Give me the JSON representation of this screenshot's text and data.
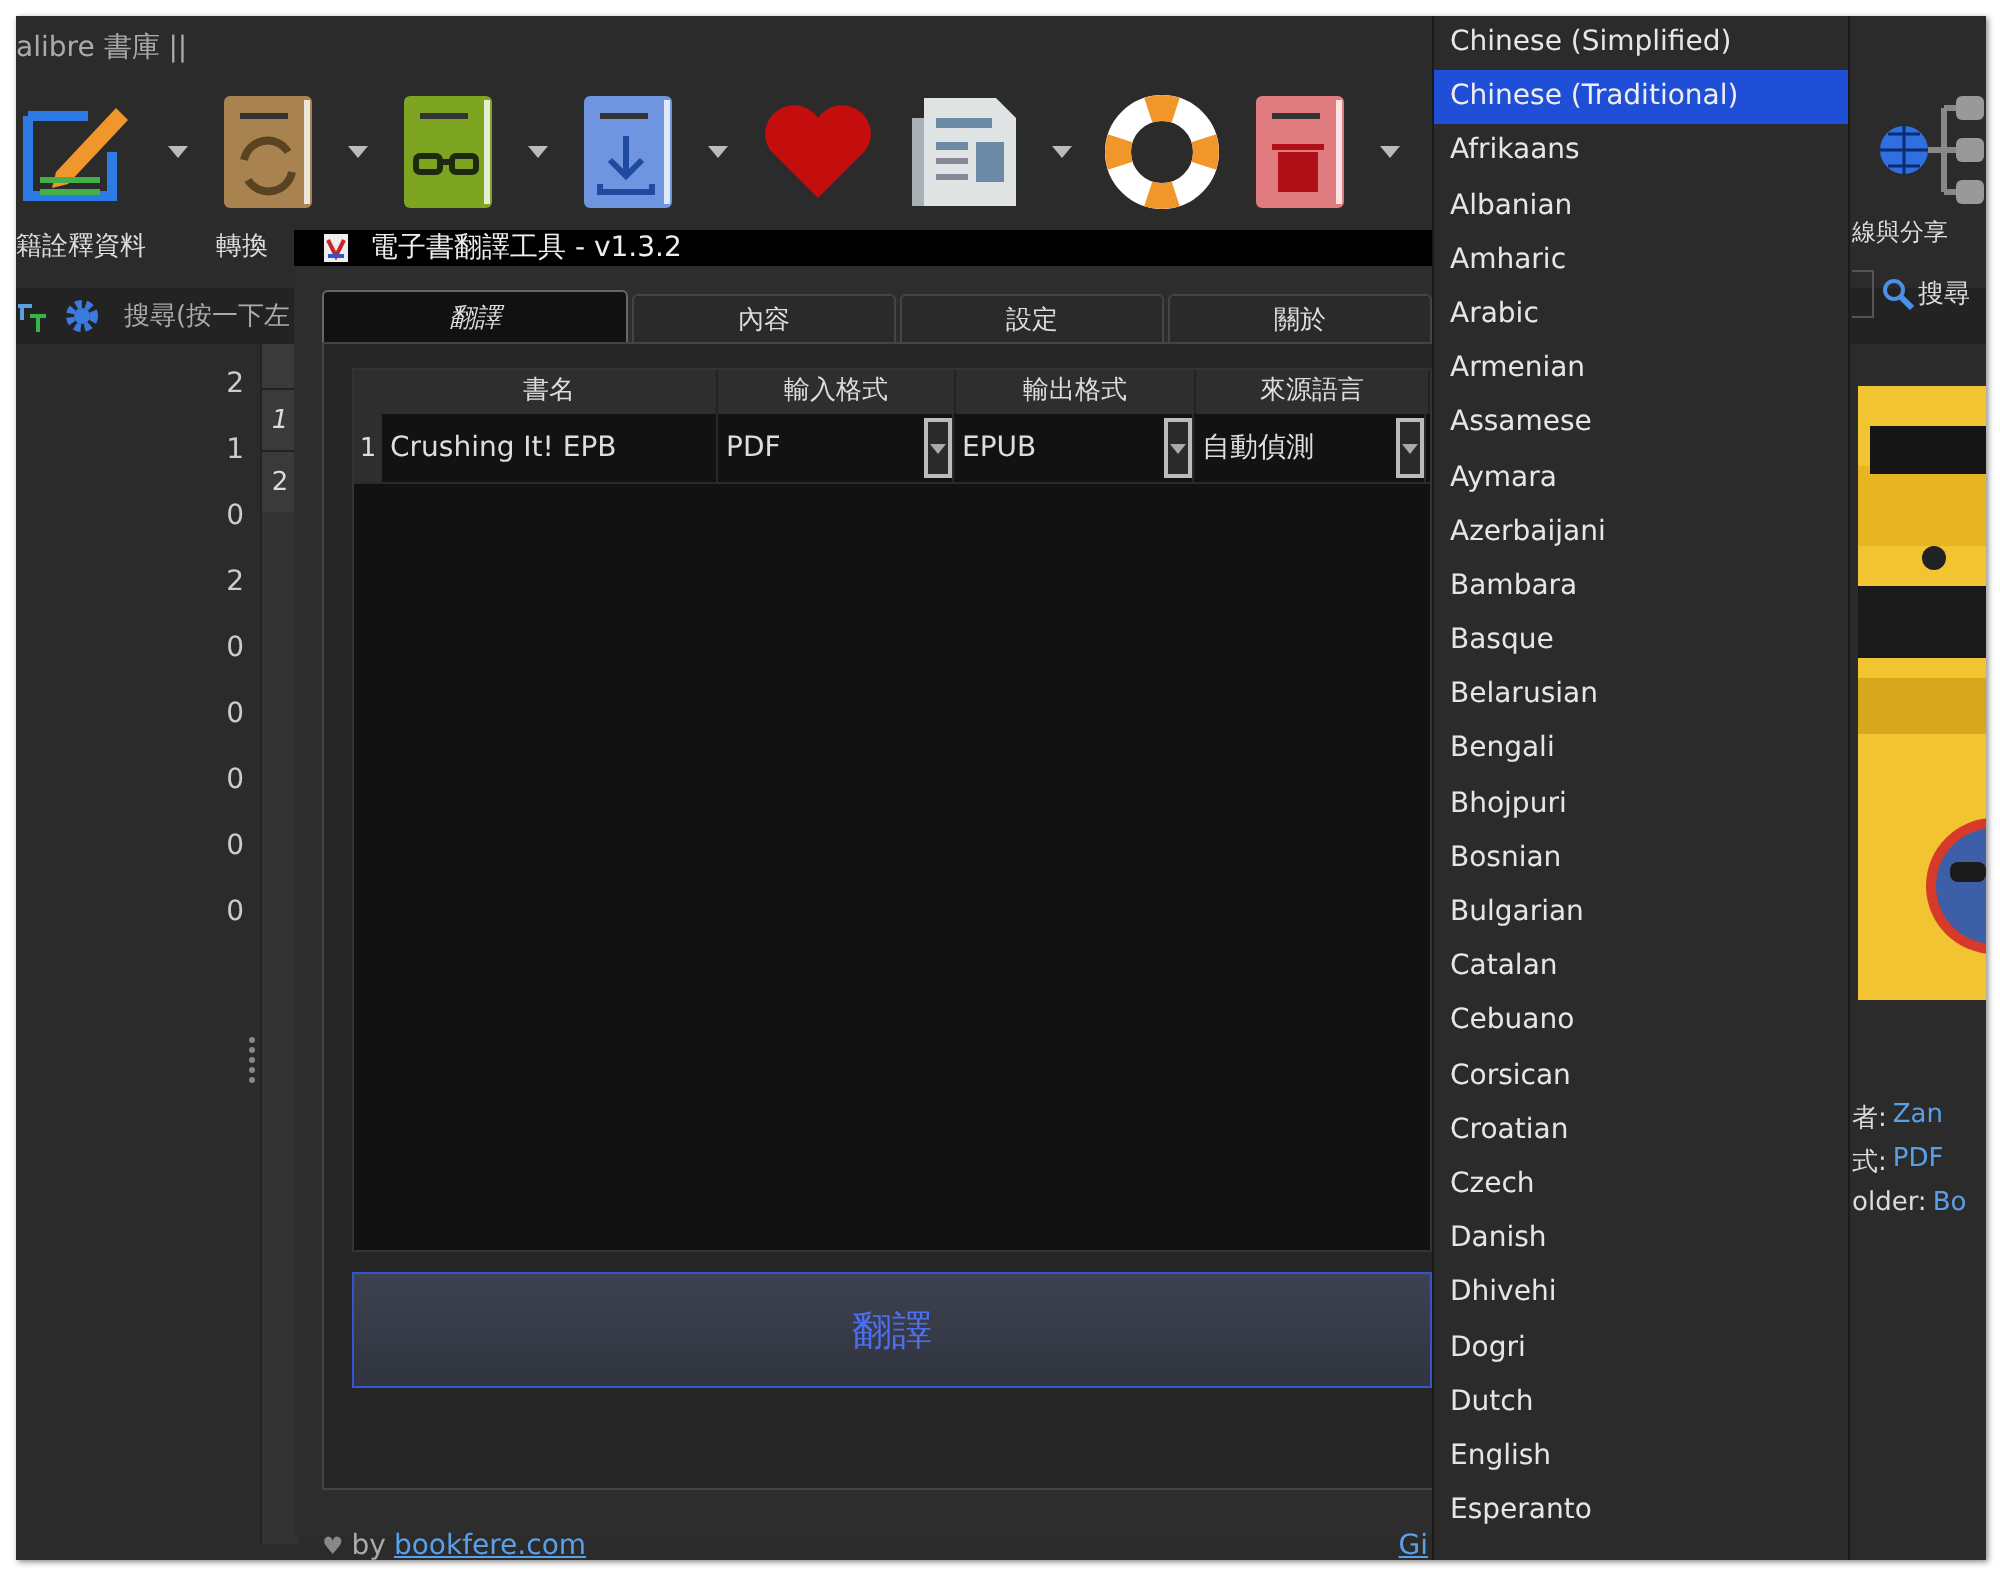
{
  "window": {
    "title": "alibre 書庫 ||"
  },
  "toolbar": {
    "items": [
      {
        "kind": "edit",
        "label": "籍詮釋資料",
        "caret": true
      },
      {
        "kind": "convert",
        "label": "轉換",
        "caret": true
      },
      {
        "kind": "read",
        "caret": true
      },
      {
        "kind": "download",
        "caret": true
      },
      {
        "kind": "heart",
        "caret": false
      },
      {
        "kind": "news",
        "caret": true
      },
      {
        "kind": "help",
        "caret": false
      },
      {
        "kind": "remove",
        "caret": true
      }
    ],
    "share_label": "線與分享"
  },
  "search": {
    "placeholder": "搜尋(按一下左",
    "button": "搜尋"
  },
  "counts": [
    "2",
    "1",
    "0",
    "2",
    "0",
    "0",
    "0",
    "0",
    "0"
  ],
  "row_numbers": [
    "1",
    "2"
  ],
  "dialog": {
    "title": "電子書翻譯工具 - v1.3.2",
    "tabs": [
      {
        "label": "翻譯",
        "selected": true
      },
      {
        "label": "內容",
        "selected": false
      },
      {
        "label": "設定",
        "selected": false
      },
      {
        "label": "關於",
        "selected": false
      }
    ],
    "columns": [
      "書名",
      "輸入格式",
      "輸出格式",
      "來源語言"
    ],
    "rows": [
      {
        "number": "1",
        "title": "Crushing It! EPB",
        "input_format": "PDF",
        "output_format": "EPUB",
        "source_language": "自動偵測"
      }
    ],
    "translate_button": "翻譯",
    "footer": {
      "heart": "♥",
      "by": "by",
      "link": "bookfere.com",
      "right_link": "Gi"
    }
  },
  "language_menu": [
    {
      "label": "Chinese (Simplified)",
      "selected": false
    },
    {
      "label": "Chinese (Traditional)",
      "selected": true
    },
    {
      "label": "Afrikaans",
      "selected": false
    },
    {
      "label": "Albanian",
      "selected": false
    },
    {
      "label": "Amharic",
      "selected": false
    },
    {
      "label": "Arabic",
      "selected": false
    },
    {
      "label": "Armenian",
      "selected": false
    },
    {
      "label": "Assamese",
      "selected": false
    },
    {
      "label": "Aymara",
      "selected": false
    },
    {
      "label": "Azerbaijani",
      "selected": false
    },
    {
      "label": "Bambara",
      "selected": false
    },
    {
      "label": "Basque",
      "selected": false
    },
    {
      "label": "Belarusian",
      "selected": false
    },
    {
      "label": "Bengali",
      "selected": false
    },
    {
      "label": "Bhojpuri",
      "selected": false
    },
    {
      "label": "Bosnian",
      "selected": false
    },
    {
      "label": "Bulgarian",
      "selected": false
    },
    {
      "label": "Catalan",
      "selected": false
    },
    {
      "label": "Cebuano",
      "selected": false
    },
    {
      "label": "Corsican",
      "selected": false
    },
    {
      "label": "Croatian",
      "selected": false
    },
    {
      "label": "Czech",
      "selected": false
    },
    {
      "label": "Danish",
      "selected": false
    },
    {
      "label": "Dhivehi",
      "selected": false
    },
    {
      "label": "Dogri",
      "selected": false
    },
    {
      "label": "Dutch",
      "selected": false
    },
    {
      "label": "English",
      "selected": false
    },
    {
      "label": "Esperanto",
      "selected": false
    }
  ],
  "details": [
    {
      "label": "者:",
      "value": "Zan"
    },
    {
      "label": "式:",
      "value": "PDF"
    },
    {
      "label": "older:",
      "value": "Bo"
    }
  ]
}
